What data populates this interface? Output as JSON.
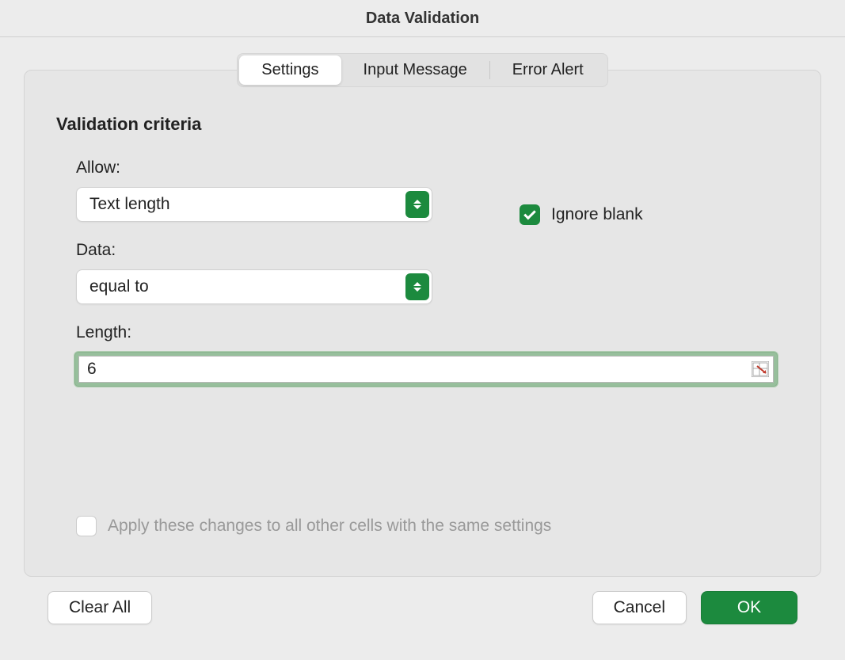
{
  "dialog": {
    "title": "Data Validation"
  },
  "tabs": {
    "settings": "Settings",
    "input_message": "Input Message",
    "error_alert": "Error Alert"
  },
  "section": {
    "title": "Validation criteria"
  },
  "fields": {
    "allow_label": "Allow:",
    "allow_value": "Text length",
    "data_label": "Data:",
    "data_value": "equal to",
    "length_label": "Length:",
    "length_value": "6"
  },
  "checkboxes": {
    "ignore_blank_label": "Ignore blank",
    "ignore_blank_checked": true,
    "apply_all_label": "Apply these changes to all other cells with the same settings",
    "apply_all_checked": false
  },
  "buttons": {
    "clear_all": "Clear All",
    "cancel": "Cancel",
    "ok": "OK"
  }
}
